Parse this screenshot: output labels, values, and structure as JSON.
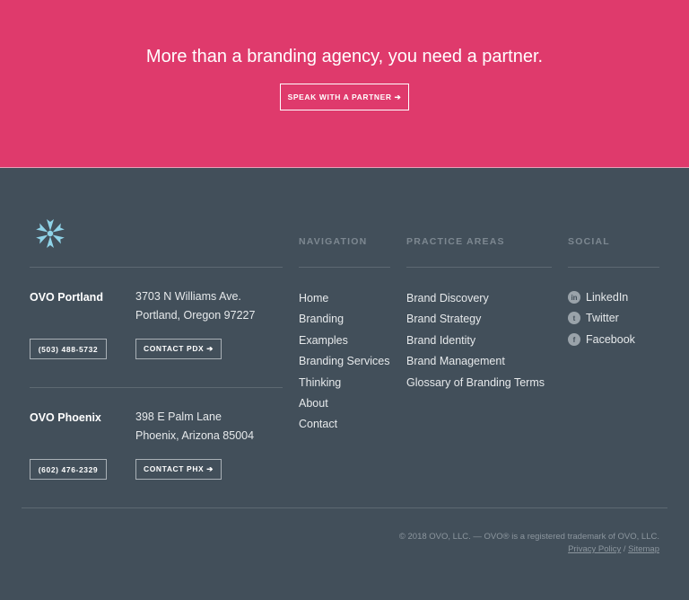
{
  "cta": {
    "headline": "More than a branding agency, you need a partner.",
    "button_label": "SPEAK WITH A PARTNER ➔"
  },
  "footer": {
    "columns": {
      "navigation": "NAVIGATION",
      "practice": "PRACTICE AREAS",
      "social": "SOCIAL"
    },
    "offices": [
      {
        "name": "OVO Portland",
        "address_line1": "3703 N Williams Ave.",
        "address_line2": "Portland, Oregon 97227",
        "phone": "(503) 488-5732",
        "contact_label": "CONTACT PDX ➔"
      },
      {
        "name": "OVO Phoenix",
        "address_line1": "398 E Palm Lane",
        "address_line2": "Phoenix, Arizona 85004",
        "phone": "(602) 476-2329",
        "contact_label": "CONTACT PHX ➔"
      }
    ],
    "navigation": [
      "Home",
      "Branding",
      "Examples",
      "Branding Services",
      "Thinking",
      "About",
      "Contact"
    ],
    "practice_areas": [
      "Brand Discovery",
      "Brand Strategy",
      "Brand Identity",
      "Brand Management",
      "Glossary of Branding Terms"
    ],
    "social": [
      {
        "label": "LinkedIn",
        "icon": "linkedin-icon",
        "glyph": "in"
      },
      {
        "label": "Twitter",
        "icon": "twitter-icon",
        "glyph": "t"
      },
      {
        "label": "Facebook",
        "icon": "facebook-icon",
        "glyph": "f"
      }
    ],
    "copyright": "© 2018 OVO, LLC. — OVO® is a registered trademark of OVO, LLC.",
    "privacy_label": "Privacy Policy",
    "separator": "/",
    "sitemap_label": "Sitemap"
  },
  "colors": {
    "cta_background": "#df3a6c",
    "footer_background": "#424f5a",
    "logo": "#8fd3e8"
  }
}
